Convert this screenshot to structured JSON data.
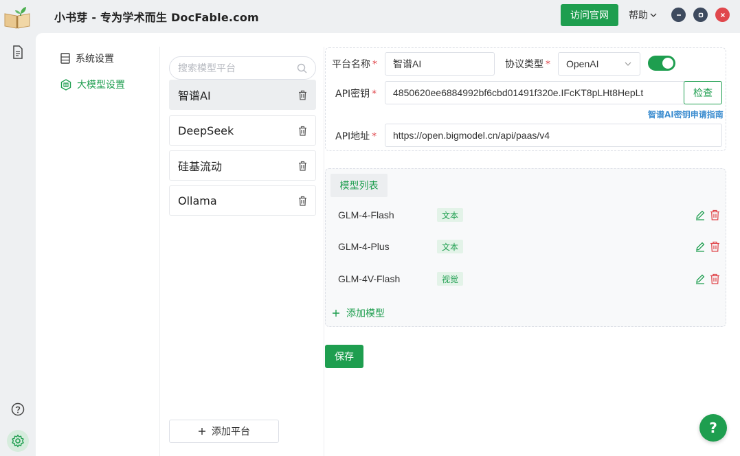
{
  "app": {
    "title": "小书芽 - 专为学术而生 DocFable.com",
    "visit_label": "访问官网",
    "help_label": "帮助"
  },
  "nav": {
    "items": [
      {
        "label": "系统设置",
        "icon": "list-icon"
      },
      {
        "label": "大模型设置",
        "icon": "model-icon",
        "active": true
      }
    ]
  },
  "platforms": {
    "search_placeholder": "搜索模型平台",
    "items": [
      {
        "label": "智谱AI",
        "active": true
      },
      {
        "label": "DeepSeek"
      },
      {
        "label": "硅基流动"
      },
      {
        "label": "Ollama"
      }
    ],
    "add_label": "添加平台"
  },
  "form": {
    "name_label": "平台名称",
    "name_value": "智谱AI",
    "protocol_label": "协议类型",
    "protocol_value": "OpenAI",
    "enabled": true,
    "key_label": "API密钥",
    "key_value": "4850620ee6884992bf6cbd01491f320e.IFcKT8pLHt8HepLt",
    "check_label": "检查",
    "guide_label": "智谱AI密钥申请指南",
    "url_label": "API地址",
    "url_value": "https://open.bigmodel.cn/api/paas/v4",
    "required_mark": "*"
  },
  "models": {
    "tab_label": "模型列表",
    "items": [
      {
        "name": "GLM-4-Flash",
        "tag": "文本"
      },
      {
        "name": "GLM-4-Plus",
        "tag": "文本"
      },
      {
        "name": "GLM-4V-Flash",
        "tag": "视觉"
      }
    ],
    "add_label": "添加模型"
  },
  "save_label": "保存",
  "fab_label": "?",
  "colors": {
    "accent": "#1e9e4f",
    "danger": "#e0474c",
    "link": "#3e8ed0"
  }
}
